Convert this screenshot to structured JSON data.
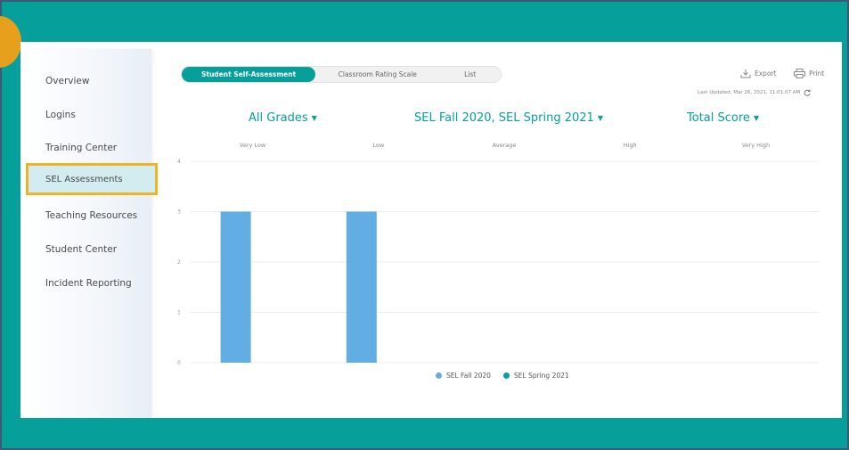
{
  "sidebar": {
    "items": [
      {
        "label": "Overview"
      },
      {
        "label": "Logins"
      },
      {
        "label": "Training Center"
      },
      {
        "label": "SEL Assessments"
      },
      {
        "label": "Teaching Resources"
      },
      {
        "label": "Student Center"
      },
      {
        "label": "Incident Reporting"
      }
    ],
    "active": "SEL Assessments"
  },
  "tabs": [
    {
      "label": "Student Self-Assessment",
      "active": true
    },
    {
      "label": "Classroom Rating Scale",
      "active": false
    },
    {
      "label": "List",
      "active": false
    }
  ],
  "toolbar": {
    "export_label": "Export",
    "print_label": "Print",
    "last_updated": "Last Updated: Mar 26, 2021, 11:01:07 AM"
  },
  "filters": {
    "grades": "All Grades",
    "assessments": "SEL Fall 2020, SEL Spring 2021",
    "score": "Total Score"
  },
  "colors": {
    "accent": "#069f9a",
    "fall": "#62ade4",
    "spring": "#069f9a",
    "highlight": "#f0b323"
  },
  "chart_data": {
    "type": "bar",
    "categories": [
      "Very Low",
      "Low",
      "Average",
      "High",
      "Very High"
    ],
    "series": [
      {
        "name": "SEL Fall 2020",
        "values": [
          3,
          3,
          0,
          0,
          0
        ]
      },
      {
        "name": "SEL Spring 2021",
        "values": [
          0,
          0,
          0,
          0,
          0
        ]
      }
    ],
    "yticks": [
      "0",
      "1",
      "2",
      "3",
      "4"
    ],
    "ylim": [
      0,
      4
    ],
    "grid": true,
    "legend_position": "bottom-center"
  }
}
